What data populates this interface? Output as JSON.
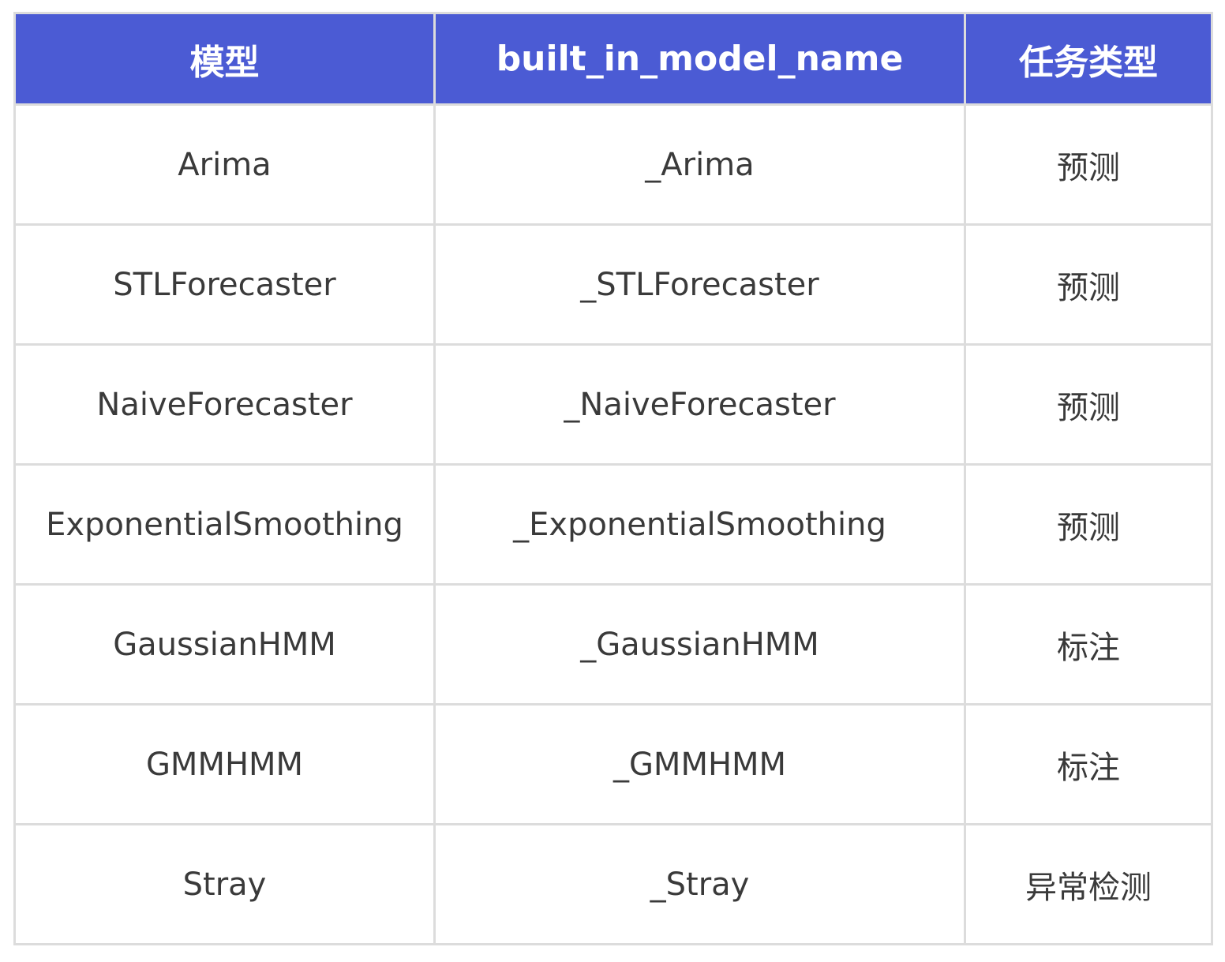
{
  "table": {
    "headers": [
      "模型",
      "built_in_model_name",
      "任务类型"
    ],
    "rows": [
      {
        "model": "Arima",
        "built_in_model_name": "_Arima",
        "task_type": "预测"
      },
      {
        "model": "STLForecaster",
        "built_in_model_name": "_STLForecaster",
        "task_type": "预测"
      },
      {
        "model": "NaiveForecaster",
        "built_in_model_name": "_NaiveForecaster",
        "task_type": "预测"
      },
      {
        "model": "ExponentialSmoothing",
        "built_in_model_name": "_ExponentialSmoothing",
        "task_type": "预测"
      },
      {
        "model": "GaussianHMM",
        "built_in_model_name": "_GaussianHMM",
        "task_type": "标注"
      },
      {
        "model": "GMMHMM",
        "built_in_model_name": "_GMMHMM",
        "task_type": "标注"
      },
      {
        "model": "Stray",
        "built_in_model_name": "_Stray",
        "task_type": "异常检测"
      }
    ]
  },
  "colors": {
    "header_background": "#4b5bd4",
    "header_text": "#ffffff",
    "cell_text": "#3a3a3a",
    "border": "#dcdcdc"
  }
}
